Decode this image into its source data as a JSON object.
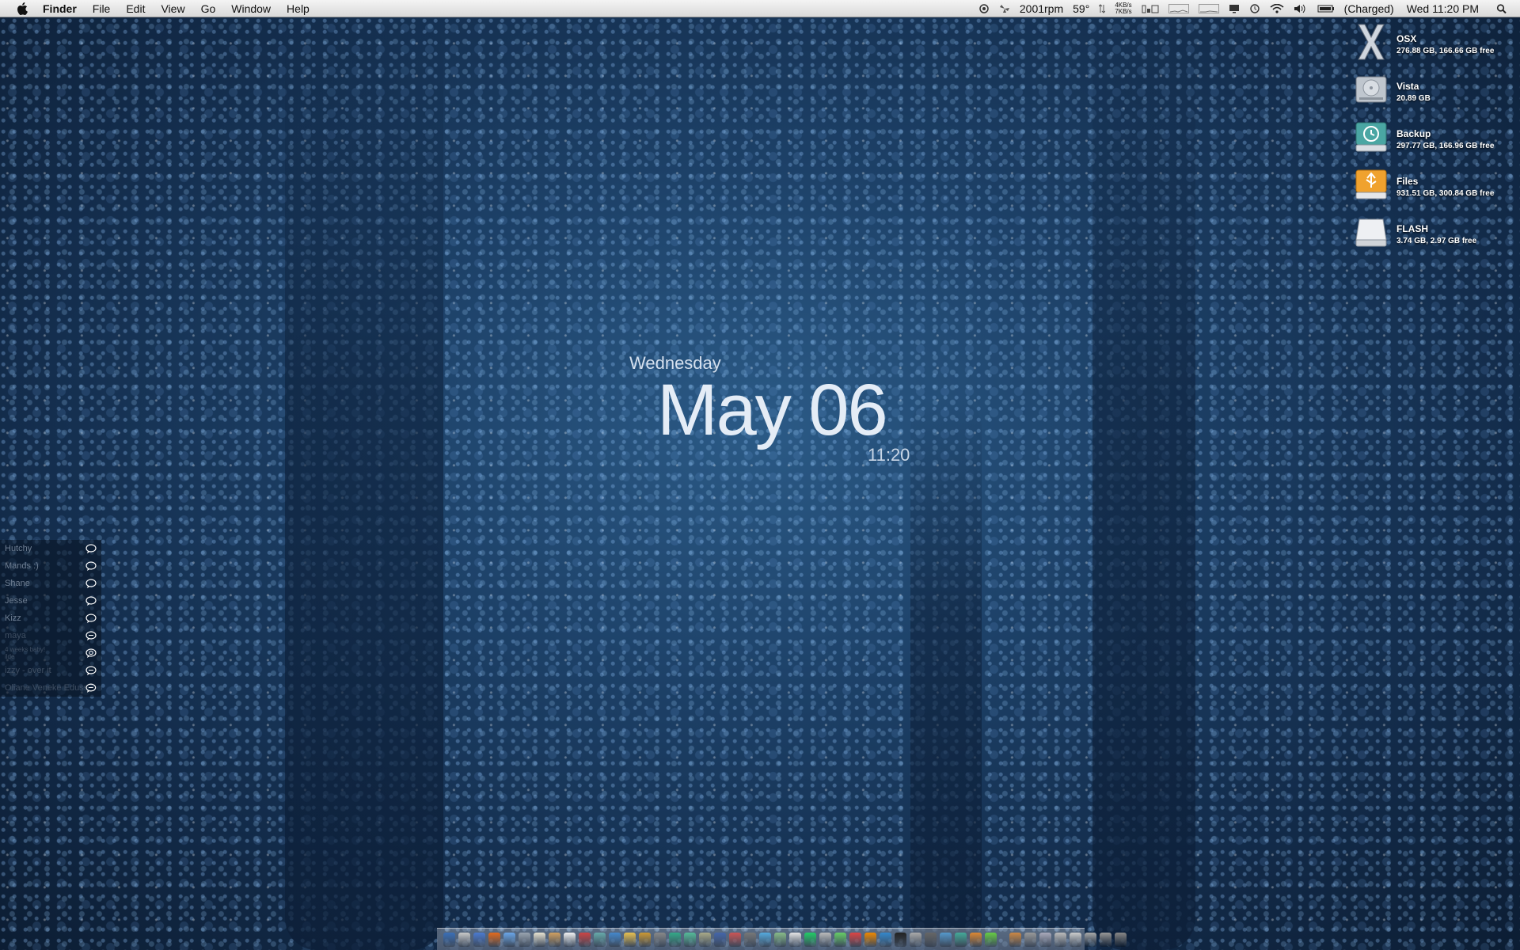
{
  "menubar": {
    "app_name": "Finder",
    "menus": [
      "File",
      "Edit",
      "View",
      "Go",
      "Window",
      "Help"
    ],
    "fan_speed": "2001rpm",
    "temperature": "59°",
    "net_up": "4KB/s",
    "net_down": "7KB/s",
    "battery_status": "(Charged)",
    "clock": "Wed 11:20 PM"
  },
  "desktop_clock": {
    "day": "Wednesday",
    "date": "May 06",
    "time": "11:20"
  },
  "drives": [
    {
      "name": "OSX",
      "info": "276.88 GB, 166.66 GB free",
      "icon": "osx-x-icon",
      "color": "#cfd6df"
    },
    {
      "name": "Vista",
      "info": "20.89 GB",
      "icon": "hard-drive-icon",
      "color": "#bfc6ce"
    },
    {
      "name": "Backup",
      "info": "297.77 GB, 166.96 GB free",
      "icon": "time-machine-drive-icon",
      "color": "#4aa6a3"
    },
    {
      "name": "Files",
      "info": "931.51 GB, 300.84 GB free",
      "icon": "usb-drive-icon",
      "color": "#f0a22e"
    },
    {
      "name": "FLASH",
      "info": "3.74 GB, 2.97 GB free",
      "icon": "flash-drive-icon",
      "color": "#e8eaee"
    }
  ],
  "buddies": [
    {
      "name": "Hutchy",
      "sub": ""
    },
    {
      "name": "Mands :)",
      "sub": ""
    },
    {
      "name": "Shane",
      "sub": ""
    },
    {
      "name": "Jesse",
      "sub": ""
    },
    {
      "name": "Kizz",
      "sub": ""
    },
    {
      "name": "maya",
      "sub": ""
    },
    {
      "name": "4 weeks baby!",
      "sub": "ilde"
    },
    {
      "name": "izzy - over it",
      "sub": ""
    },
    {
      "name": "Oliane Veneke Eduss",
      "sub": ""
    }
  ],
  "dock_colors": [
    "#3a6fb8",
    "#c9c9c9",
    "#4b7ad0",
    "#e46a1c",
    "#6aa6e8",
    "#9aa4b0",
    "#e7e2d0",
    "#d0a060",
    "#f2f2f2",
    "#c44",
    "#6aa",
    "#48c",
    "#e8c050",
    "#c93",
    "#888",
    "#3a8",
    "#5b9",
    "#aa8",
    "#46a",
    "#c55",
    "#777",
    "#5ad",
    "#8b8",
    "#e5e5e5",
    "#2c6",
    "#bbb",
    "#6c6",
    "#d44",
    "#e80",
    "#38c",
    "#222",
    "#aaa",
    "#666",
    "#59c",
    "#4a9",
    "#d83",
    "#6c4",
    "#c84",
    "#999",
    "#aab",
    "#bbb",
    "#ccc",
    "#aaa",
    "#999",
    "#888"
  ]
}
